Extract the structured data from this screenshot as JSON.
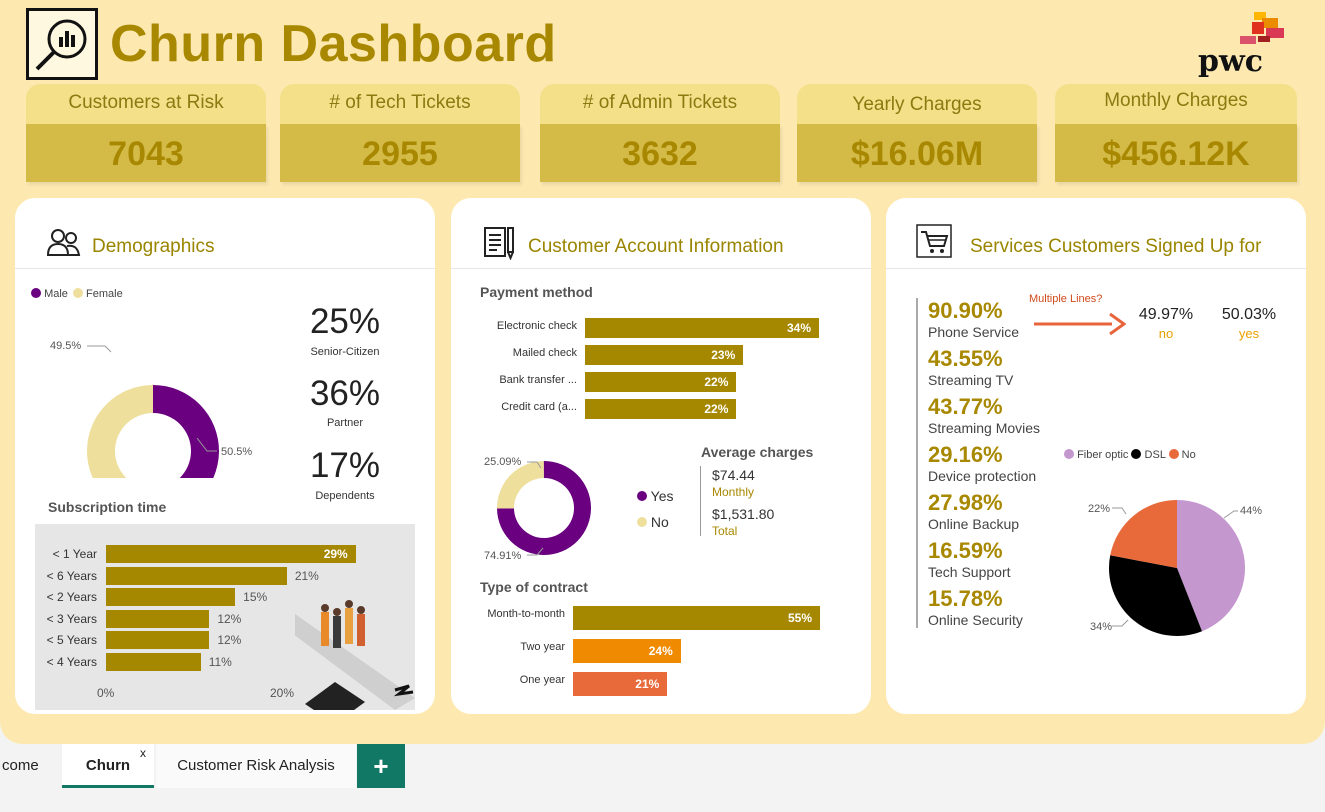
{
  "header": {
    "title": "Churn Dashboard",
    "brand": "pwc"
  },
  "kpis": [
    {
      "label": "Customers at Risk",
      "value": "7043"
    },
    {
      "label": "# of Tech Tickets",
      "value": "2955"
    },
    {
      "label": "# of Admin Tickets",
      "value": "3632"
    },
    {
      "label": "Yearly Charges",
      "value": "$16.06M"
    },
    {
      "label": "Monthly Charges",
      "value": "$456.12K"
    }
  ],
  "demographics": {
    "title": "Demographics",
    "legend": [
      "Male",
      "Female"
    ],
    "gender_labels": {
      "female": "49.5%",
      "male": "50.5%"
    },
    "stats": [
      {
        "value": "25%",
        "label": "Senior-Citizen"
      },
      {
        "value": "36%",
        "label": "Partner"
      },
      {
        "value": "17%",
        "label": "Dependents"
      }
    ],
    "subscription_title": "Subscription time",
    "axis": [
      "0%",
      "20%"
    ]
  },
  "account": {
    "title": "Customer Account Information",
    "payment_title": "Payment method",
    "avg_title": "Average charges",
    "avg_monthly": "$74.44",
    "avg_monthly_label": "Monthly",
    "avg_total": "$1,531.80",
    "avg_total_label": "Total",
    "paperless_legend": [
      "Yes",
      "No"
    ],
    "paperless_labels": {
      "no": "25.09%",
      "yes": "74.91%"
    },
    "contract_title": "Type of contract"
  },
  "services": {
    "title": "Services Customers Signed Up for",
    "list": [
      {
        "value": "90.90%",
        "name": "Phone Service"
      },
      {
        "value": "43.55%",
        "name": "Streaming TV"
      },
      {
        "value": "43.77%",
        "name": "Streaming Movies"
      },
      {
        "value": "29.16%",
        "name": "Device protection"
      },
      {
        "value": "27.98%",
        "name": "Online Backup"
      },
      {
        "value": "16.59%",
        "name": "Tech Support"
      },
      {
        "value": "15.78%",
        "name": "Online Security"
      }
    ],
    "multiple_lines_label": "Multiple Lines?",
    "ml_no": "49.97%",
    "ml_no_label": "no",
    "ml_yes": "50.03%",
    "ml_yes_label": "yes",
    "internet_legend": [
      "Fiber optic",
      "DSL",
      "No"
    ],
    "internet_labels": {
      "fiber": "44%",
      "dsl": "34%",
      "no": "22%"
    }
  },
  "tabs": {
    "t1": "come",
    "t2": "Churn",
    "t2_close": "x",
    "t3": "Customer Risk Analysis",
    "add": "+"
  },
  "colors": {
    "gold": "#a68700",
    "purple": "#6a0080",
    "cream": "#eedf9c",
    "orange": "#f08a00",
    "burnt": "#e86a3a",
    "lilac": "#c497cf"
  },
  "chart_data": [
    {
      "type": "pie",
      "categories": [
        "Male",
        "Female"
      ],
      "values": [
        50.5,
        49.5
      ]
    },
    {
      "type": "bar",
      "title": "Subscription time",
      "categories": [
        "< 1 Year",
        "< 6 Years",
        "< 2 Years",
        "< 3 Years",
        "< 5 Years",
        "< 4 Years"
      ],
      "values": [
        29,
        21,
        15,
        12,
        12,
        11
      ],
      "labels": [
        "29%",
        "21%",
        "15%",
        "12%",
        "12%",
        "11%"
      ],
      "xlim": [
        0,
        36
      ]
    },
    {
      "type": "bar",
      "title": "Payment method",
      "categories": [
        "Electronic check",
        "Mailed check",
        "Bank transfer ...",
        "Credit card (a..."
      ],
      "values": [
        34,
        23,
        22,
        22
      ],
      "labels": [
        "34%",
        "23%",
        "22%",
        "22%"
      ],
      "xlim": [
        0,
        34
      ]
    },
    {
      "type": "pie",
      "categories": [
        "Yes",
        "No"
      ],
      "values": [
        74.91,
        25.09
      ]
    },
    {
      "type": "bar",
      "title": "Type of contract",
      "categories": [
        "Month-to-month",
        "Two year",
        "One year"
      ],
      "values": [
        55,
        24,
        21
      ],
      "labels": [
        "55%",
        "24%",
        "21%"
      ],
      "xlim": [
        0,
        55
      ]
    },
    {
      "type": "pie",
      "categories": [
        "Fiber optic",
        "DSL",
        "No"
      ],
      "values": [
        44,
        34,
        22
      ]
    }
  ]
}
